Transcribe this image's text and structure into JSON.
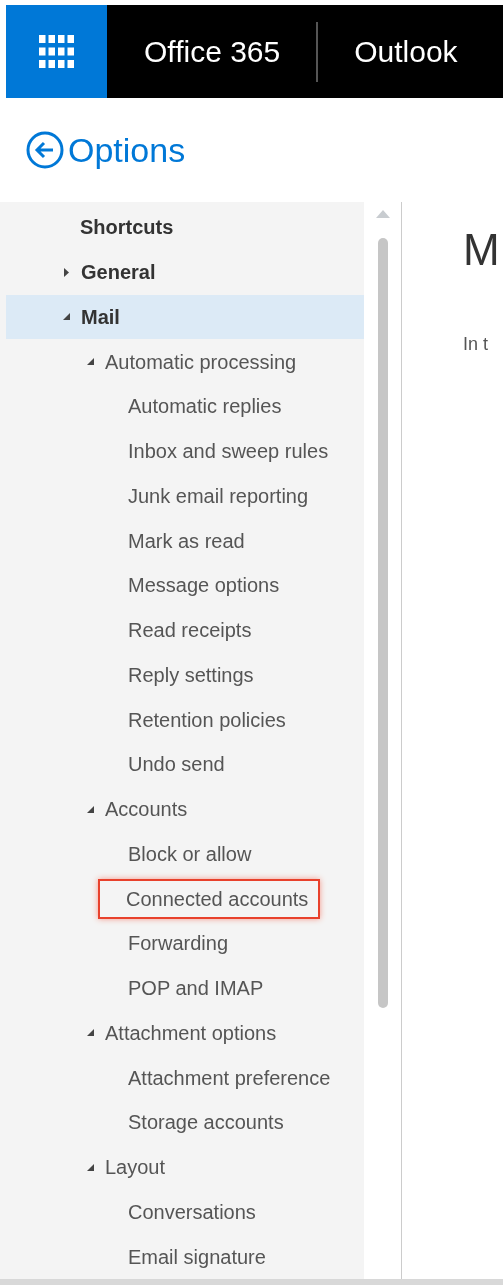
{
  "topbar": {
    "brand": "Office 365",
    "app": "Outlook"
  },
  "options_title": "Options",
  "tree": [
    {
      "label": "Shortcuts",
      "bold": true,
      "selected": false,
      "highlighted": false
    },
    {
      "label": "General",
      "bold": true,
      "expanded": false,
      "selected": false,
      "highlighted": false
    },
    {
      "label": "Mail",
      "bold": true,
      "expanded": true,
      "selected": true,
      "highlighted": false,
      "children": [
        {
          "label": "Automatic processing",
          "expanded": true,
          "selected": false,
          "highlighted": false,
          "children": [
            {
              "label": "Automatic replies",
              "selected": false,
              "highlighted": false
            },
            {
              "label": "Inbox and sweep rules",
              "selected": false,
              "highlighted": false
            },
            {
              "label": "Junk email reporting",
              "selected": false,
              "highlighted": false
            },
            {
              "label": "Mark as read",
              "selected": false,
              "highlighted": false
            },
            {
              "label": "Message options",
              "selected": false,
              "highlighted": false
            },
            {
              "label": "Read receipts",
              "selected": false,
              "highlighted": false
            },
            {
              "label": "Reply settings",
              "selected": false,
              "highlighted": false
            },
            {
              "label": "Retention policies",
              "selected": false,
              "highlighted": false
            },
            {
              "label": "Undo send",
              "selected": false,
              "highlighted": false
            }
          ]
        },
        {
          "label": "Accounts",
          "expanded": true,
          "selected": false,
          "highlighted": false,
          "children": [
            {
              "label": "Block or allow",
              "selected": false,
              "highlighted": false
            },
            {
              "label": "Connected accounts",
              "selected": false,
              "highlighted": true
            },
            {
              "label": "Forwarding",
              "selected": false,
              "highlighted": false
            },
            {
              "label": "POP and IMAP",
              "selected": false,
              "highlighted": false
            }
          ]
        },
        {
          "label": "Attachment options",
          "expanded": true,
          "selected": false,
          "highlighted": false,
          "children": [
            {
              "label": "Attachment preference",
              "selected": false,
              "highlighted": false
            },
            {
              "label": "Storage accounts",
              "selected": false,
              "highlighted": false
            }
          ]
        },
        {
          "label": "Layout",
          "expanded": true,
          "selected": false,
          "highlighted": false,
          "children": [
            {
              "label": "Conversations",
              "selected": false,
              "highlighted": false
            },
            {
              "label": "Email signature",
              "selected": false,
              "highlighted": false
            }
          ]
        }
      ]
    }
  ],
  "content": {
    "title": "M",
    "text": "In t"
  }
}
